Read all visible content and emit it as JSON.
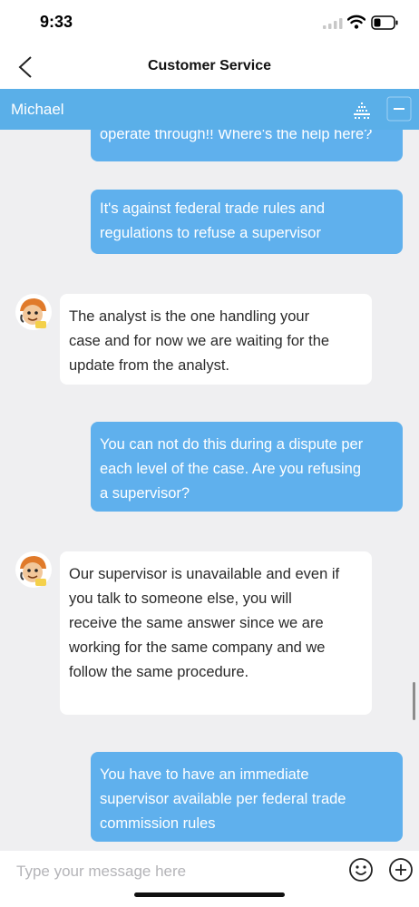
{
  "status": {
    "time": "9:33"
  },
  "header": {
    "title": "Customer Service"
  },
  "agent_bar": {
    "name": "Michael"
  },
  "messages": [
    {
      "from": "user",
      "lines": [
        "operate through!! Where's the help here?"
      ]
    },
    {
      "from": "user",
      "lines": [
        "It's against federal trade rules and",
        "regulations to refuse a supervisor"
      ]
    },
    {
      "from": "agent",
      "lines": [
        "The analyst is the one handling your",
        "case and for now we are waiting for the",
        "update from the analyst."
      ]
    },
    {
      "from": "user",
      "lines": [
        "You can not do this during a dispute per",
        "each level of the case. Are you refusing",
        "a supervisor?"
      ]
    },
    {
      "from": "agent",
      "lines": [
        "Our supervisor is unavailable and even if",
        "you talk to someone else, you will",
        "receive the same answer since we are",
        "working for the same company and we",
        "follow the same procedure."
      ]
    },
    {
      "from": "user",
      "lines": [
        "You have to have an immediate",
        "supervisor available per federal trade",
        "commission rules"
      ]
    }
  ],
  "composer": {
    "placeholder": "Type your message here",
    "value": ""
  },
  "colors": {
    "accent": "#5aafe8",
    "user_bubble": "#5fb0ed",
    "background": "#efeff1"
  }
}
